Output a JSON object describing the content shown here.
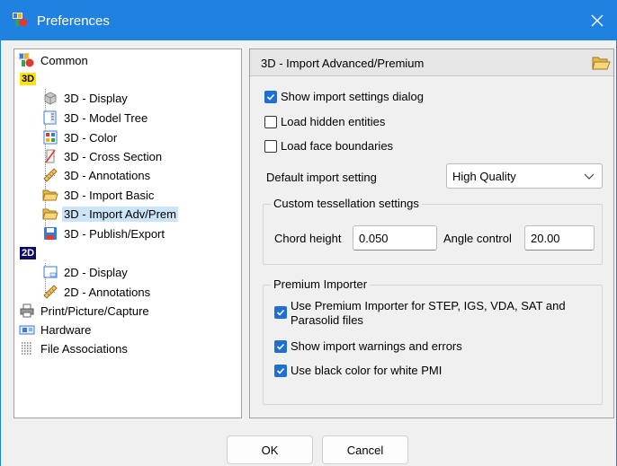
{
  "window": {
    "title": "Preferences"
  },
  "tree": {
    "common": "Common",
    "group3d_badge": "3D",
    "items3d": [
      "3D - Display",
      "3D - Model Tree",
      "3D - Color",
      "3D - Cross Section",
      "3D - Annotations",
      "3D - Import Basic",
      "3D - Import Adv/Prem",
      "3D - Publish/Export"
    ],
    "group2d_badge": "2D",
    "items2d": [
      "2D - Display",
      "2D - Annotations"
    ],
    "print": "Print/Picture/Capture",
    "hardware": "Hardware",
    "file_assoc": "File Associations",
    "selected": "3D - Import Adv/Prem"
  },
  "panel": {
    "title": "3D - Import Advanced/Premium",
    "show_dialog": {
      "label": "Show import settings dialog",
      "checked": true
    },
    "load_hidden": {
      "label": "Load hidden entities",
      "checked": false
    },
    "load_face": {
      "label": "Load face boundaries",
      "checked": false
    },
    "default_import_label": "Default import setting",
    "default_import_value": "High Quality",
    "tess_group_title": "Custom tessellation settings",
    "chord_label": "Chord height",
    "chord_value": "0.050",
    "angle_label": "Angle control",
    "angle_value": "20.00",
    "premium_group_title": "Premium Importer",
    "use_premium": {
      "label_line1": "Use Premium Importer for STEP, IGS, VDA, SAT and",
      "label_line2": "Parasolid files",
      "checked": true
    },
    "show_warnings": {
      "label": "Show import warnings and errors",
      "checked": true
    },
    "black_pmi": {
      "label": "Use black color for white PMI",
      "checked": true
    }
  },
  "buttons": {
    "ok": "OK",
    "cancel": "Cancel"
  },
  "colors": {
    "titlebar": "#1f82e0",
    "checkbox_on": "#1f6fd0",
    "selection": "#cce4f7"
  }
}
